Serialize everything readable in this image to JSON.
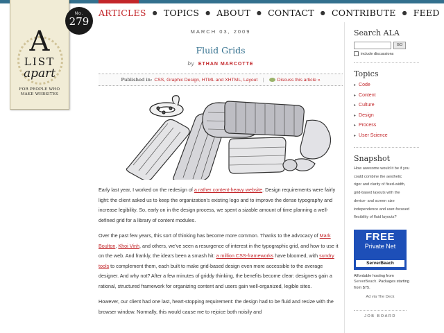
{
  "logo": {
    "letter": "A",
    "list": "LIST",
    "apart": "apart",
    "tagline": "FOR PEOPLE WHO MAKE WEBSITES"
  },
  "issue": {
    "prefix": "No.",
    "number": "279"
  },
  "nav": {
    "items": [
      "ARTICLES",
      "TOPICS",
      "ABOUT",
      "CONTACT",
      "CONTRIBUTE",
      "FEED"
    ],
    "active": "ARTICLES"
  },
  "article": {
    "date": "MARCH 03, 2009",
    "title": "Fluid Grids",
    "by": "by",
    "author": "ETHAN MARCOTTE",
    "published_label": "Published in:",
    "categories": "CSS, Graphic Design, HTML and XHTML, Layout",
    "discuss": "Discuss this article »",
    "p1": {
      "a": "Early last year, I worked on the redesign of ",
      "link": "a rather content-heavy website",
      "b": ". Design requirements were fairly light: the client asked us to keep the organization’s existing logo and to improve the dense typography and increase legibility. So, early on in the design process, we spent a sizable amount of time planning a well-defined grid for a library of content modules."
    },
    "p2": {
      "a": "Over the past few years, this sort of thinking has become more common. Thanks to the advocacy of ",
      "l1": "Mark Boulton",
      "b": ", ",
      "l2": "Khoi Vinh",
      "c": ", and others, we’ve seen a resurgence of interest in the typographic grid, and how to use it on the web. And frankly, the idea’s been a smash hit: ",
      "l3": "a million CSS-frameworks",
      "d": " have bloomed, with ",
      "l4": "sundry tools",
      "e": " to complement them, each built to make grid-based design even more accessible to the average designer. And why not? After a few minutes of griddy thinking, the benefits become clear: designers gain a rational, structured framework for organizing content and users gain well-organized, legible sites."
    },
    "p3": "However, our client had one last, heart-stopping requirement: the design had to be fluid and resize with the browser window. Normally, this would cause me to rejoice both noisily and"
  },
  "sidebar": {
    "search_heading": "Search ALA",
    "search_value": "",
    "go_label": "GO",
    "include_discussions": "include discussions",
    "topics_heading": "Topics",
    "topics": [
      "Code",
      "Content",
      "Culture",
      "Design",
      "Process",
      "User Science"
    ],
    "snapshot_heading": "Snapshot",
    "snapshot_text": "How awesome would it be if you could combine the aesthetic rigor and clarity of fixed-width, grid-based layouts with the device- and screen size independence and user-focused flexibility of fluid layouts?",
    "ad": {
      "free": "FREE",
      "private_net": "Private Net",
      "brand": "ServerBeach",
      "text_a": "Affordable hosting from ",
      "text_link": "ServerBeach",
      "text_b": ". Packages starting from $75.",
      "via": "Ad via The Deck"
    },
    "job_board": "JOB BOARD"
  },
  "colors": {
    "accent_red": "#c3262a",
    "title_blue": "#33708e",
    "ad_blue": "#1d4fb8"
  }
}
